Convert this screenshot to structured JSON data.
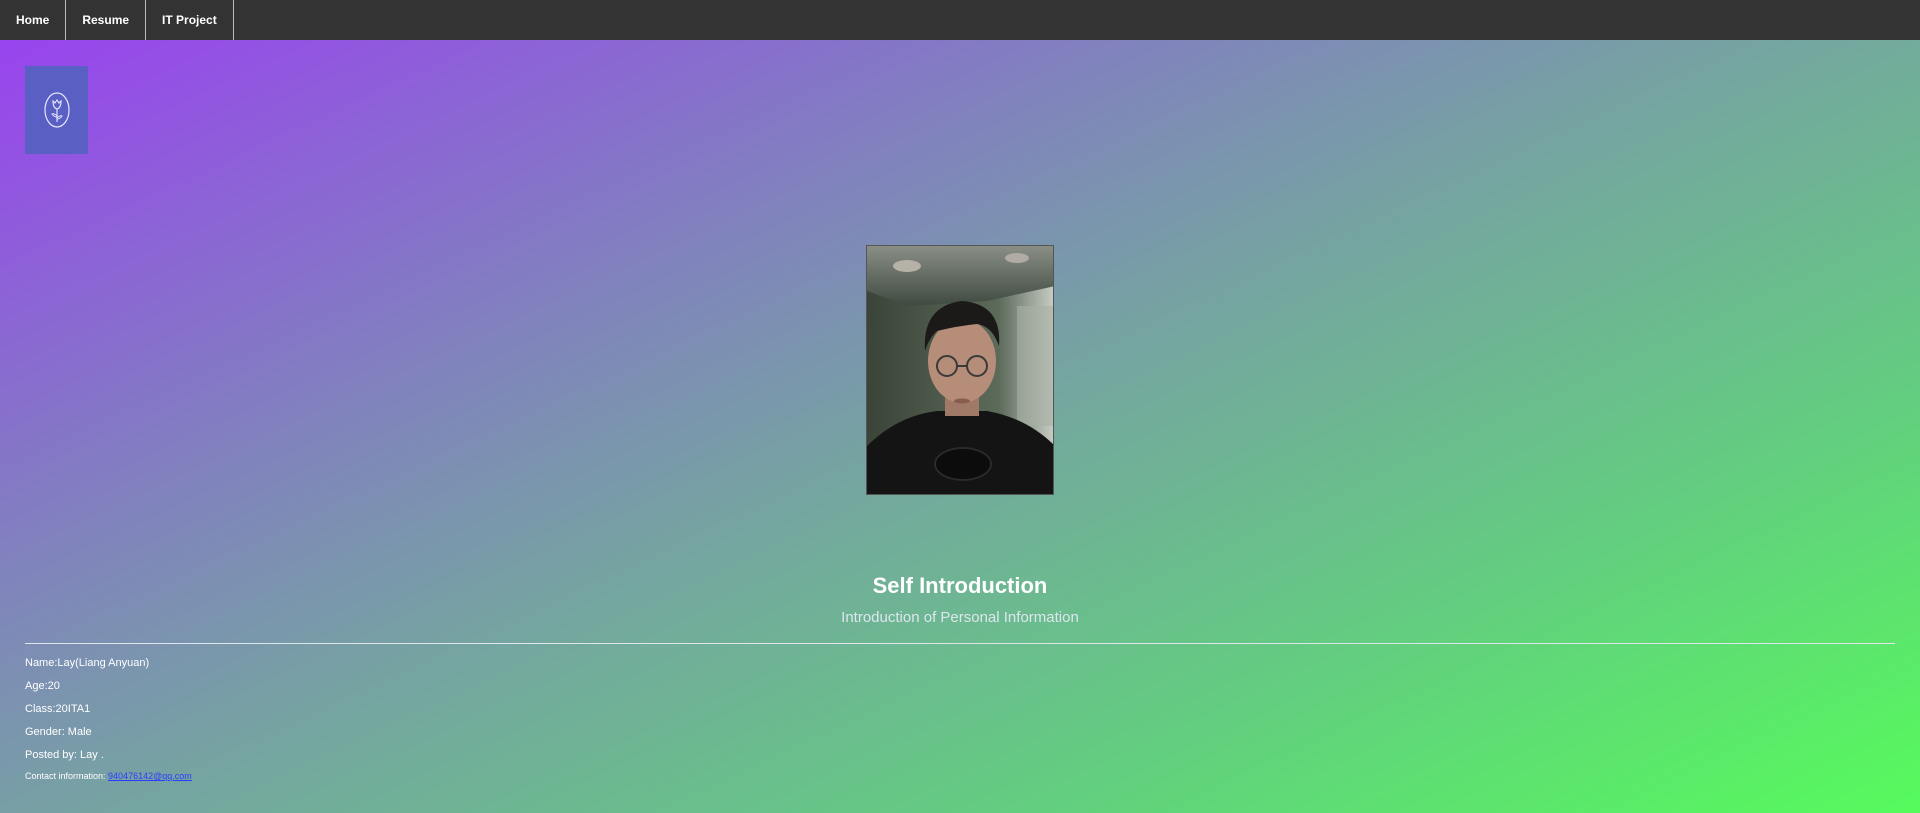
{
  "nav": {
    "items": [
      {
        "label": "Home"
      },
      {
        "label": "Resume"
      },
      {
        "label": "IT Project"
      }
    ]
  },
  "logo": {
    "icon": "tulip-icon"
  },
  "portrait": {
    "description_icon": "person-photo"
  },
  "section": {
    "title": "Self Introduction",
    "subtitle": "Introduction of Personal Information"
  },
  "info": {
    "name": "Name:Lay(Liang Anyuan)",
    "age": "Age:20",
    "class": "Class:20ITA1",
    "gender": "Gender: Male",
    "posted_by": "Posted by: Lay ."
  },
  "contact": {
    "label": "Contact information: ",
    "email": "940476142@qq.com"
  },
  "colors": {
    "navbar": "#333333",
    "gradient_start": "#9b3ff2",
    "gradient_end": "#56fb5c",
    "link": "#2a3cff"
  }
}
